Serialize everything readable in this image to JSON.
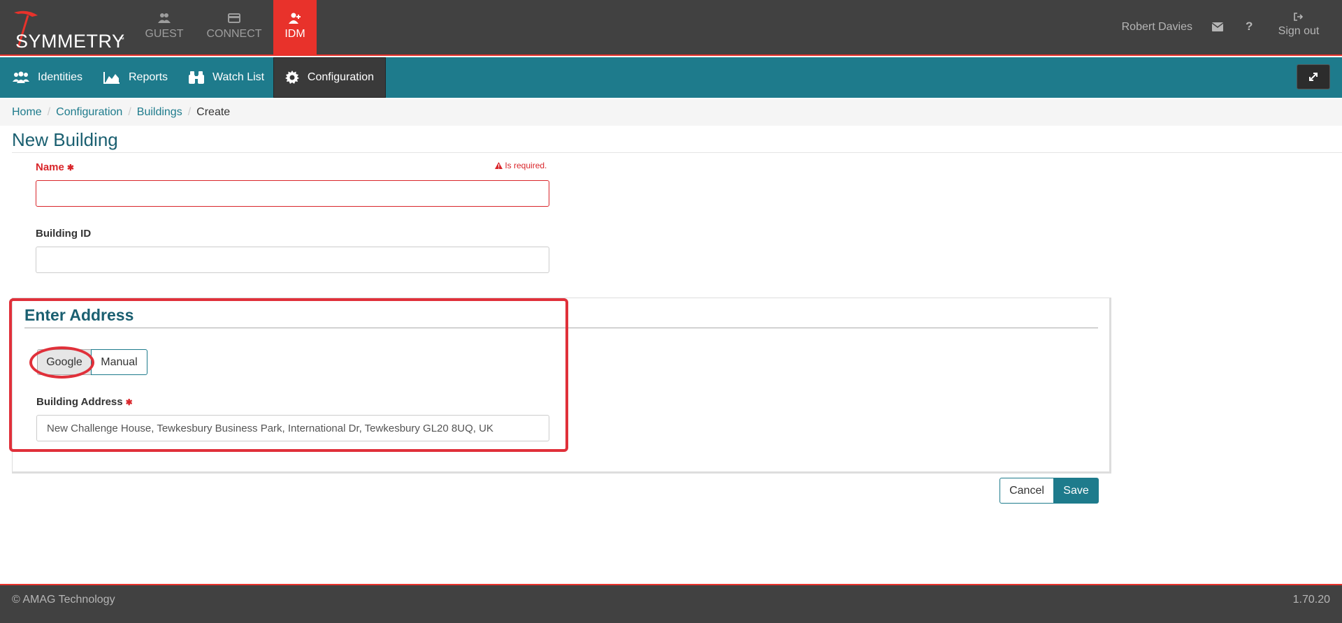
{
  "brand": {
    "name": "SYMMETRY",
    "tm": "™"
  },
  "app_tabs": [
    {
      "label": "GUEST",
      "icon": "users-icon"
    },
    {
      "label": "CONNECT",
      "icon": "card-icon"
    },
    {
      "label": "IDM",
      "icon": "user-plus-icon"
    }
  ],
  "header": {
    "user": "Robert Davies",
    "mail_icon": "envelope-icon",
    "help_label": "?",
    "signout_label": "Sign out"
  },
  "nav": {
    "identities": "Identities",
    "reports": "Reports",
    "watchlist": "Watch List",
    "configuration": "Configuration"
  },
  "breadcrumb": {
    "home": "Home",
    "configuration": "Configuration",
    "buildings": "Buildings",
    "current": "Create",
    "sep": "/"
  },
  "page_title": "New Building",
  "form": {
    "name_label": "Name",
    "required_marker": "✱",
    "name_error": "Is required.",
    "name_value": "",
    "building_id_label": "Building ID",
    "building_id_value": ""
  },
  "address": {
    "title": "Enter Address",
    "google_label": "Google",
    "manual_label": "Manual",
    "selected_mode": "Google",
    "building_address_label": "Building Address",
    "building_address_value": "New Challenge House, Tewkesbury Business Park, International Dr, Tewkesbury GL20 8UQ, UK"
  },
  "actions": {
    "cancel": "Cancel",
    "save": "Save"
  },
  "footer": {
    "copyright": "© AMAG Technology",
    "version": "1.70.20"
  },
  "colors": {
    "brand_red": "#e8322b",
    "teal": "#1e7b8c",
    "dark": "#414141",
    "annotation": "#e0303a"
  }
}
